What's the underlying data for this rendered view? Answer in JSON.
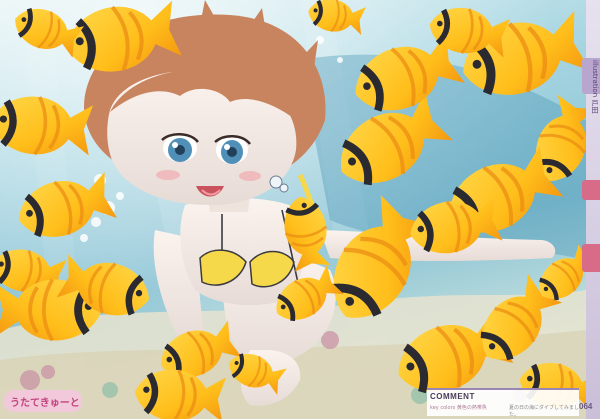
{
  "comment": {
    "title": "COMMENT",
    "subtitle": "key colors 黄色の熱帯魚",
    "note": "夏の日の海にダイブしてみました。"
  },
  "page_number": "064",
  "side_label": "illustration 戸田",
  "logo_text": "うたてきゅーと",
  "colors": {
    "water_light": "#cfe9ef",
    "water_mid": "#7fbfd2",
    "fish_yellow": "#ffc21c",
    "fish_orange": "#f59a11",
    "fish_stripe": "#2a2a30",
    "skin": "#f6ece6",
    "hair": "#c8845e",
    "swimsuit": "#f5d94a",
    "accent_lilac": "#b9a6cf"
  }
}
